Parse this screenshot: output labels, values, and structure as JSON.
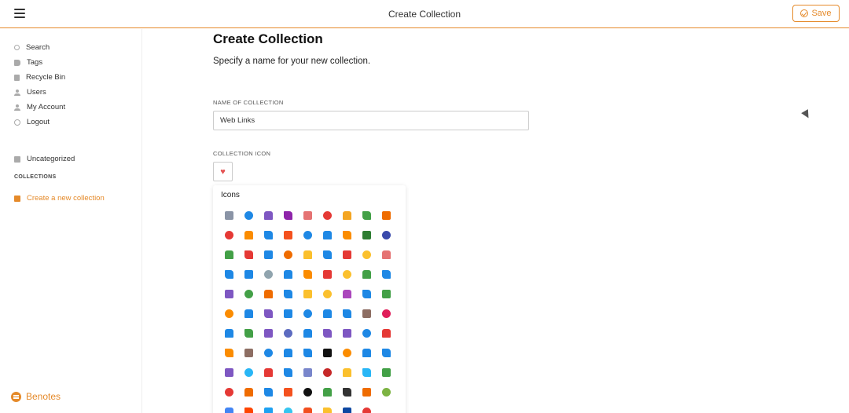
{
  "topbar": {
    "title": "Create Collection",
    "save_label": "Save"
  },
  "sidebar": {
    "items": [
      {
        "label": "Search",
        "icon": "search-icon"
      },
      {
        "label": "Tags",
        "icon": "tag-icon"
      },
      {
        "label": "Recycle Bin",
        "icon": "trash-icon"
      },
      {
        "label": "Users",
        "icon": "users-icon"
      },
      {
        "label": "My Account",
        "icon": "user-icon"
      },
      {
        "label": "Logout",
        "icon": "logout-icon"
      }
    ],
    "uncategorized": "Uncategorized",
    "collections_label": "COLLECTIONS",
    "create_link": "Create a new collection",
    "brand": "Benotes"
  },
  "main": {
    "title": "Create Collection",
    "subtitle": "Specify a name for your new collection.",
    "name_label": "NAME OF COLLECTION",
    "name_value": "Web Links",
    "icon_label": "COLLECTION ICON",
    "selected_icon": "heart-icon",
    "icons_title": "Icons"
  },
  "colors": {
    "accent": "#e58a2a",
    "heart": "#e55353"
  },
  "icons": [
    {
      "name": "folder-icon",
      "color": "#8a94a6"
    },
    {
      "name": "ring-icon",
      "color": "#1e88e5"
    },
    {
      "name": "triangle-icon",
      "color": "#7e57c2"
    },
    {
      "name": "hexagon-icon",
      "color": "#8e24aa"
    },
    {
      "name": "heart-outline-icon",
      "color": "#e57373"
    },
    {
      "name": "heart-icon",
      "color": "#e53935"
    },
    {
      "name": "star-icon",
      "color": "#f4a522"
    },
    {
      "name": "shield-icon",
      "color": "#43a047"
    },
    {
      "name": "chevron-up-icon",
      "color": "#ef6c00"
    },
    {
      "name": "user-badge-icon",
      "color": "#e53935"
    },
    {
      "name": "group-icon",
      "color": "#fb8c00"
    },
    {
      "name": "cloud-icon",
      "color": "#1e88e5"
    },
    {
      "name": "fire-icon",
      "color": "#f4511e"
    },
    {
      "name": "drop-icon",
      "color": "#1e88e5"
    },
    {
      "name": "bolt-icon",
      "color": "#1e88e5"
    },
    {
      "name": "sun-icon",
      "color": "#fb8c00"
    },
    {
      "name": "tree-icon",
      "color": "#2e7d32"
    },
    {
      "name": "lotus-icon",
      "color": "#3949ab"
    },
    {
      "name": "globe-icon",
      "color": "#43a047"
    },
    {
      "name": "compass-icon",
      "color": "#e53935"
    },
    {
      "name": "arrow-up-icon",
      "color": "#1e88e5"
    },
    {
      "name": "map-icon",
      "color": "#ef6c00"
    },
    {
      "name": "flag-icon",
      "color": "#fbc02d"
    },
    {
      "name": "flag-blue-icon",
      "color": "#1e88e5"
    },
    {
      "name": "flag-red-icon",
      "color": "#e53935"
    },
    {
      "name": "binoculars-icon",
      "color": "#fbc02d"
    },
    {
      "name": "clock-icon",
      "color": "#e57373"
    },
    {
      "name": "mail-icon",
      "color": "#1e88e5"
    },
    {
      "name": "inbox-icon",
      "color": "#1e88e5"
    },
    {
      "name": "paperclip-icon",
      "color": "#90a4ae"
    },
    {
      "name": "window-icon",
      "color": "#1e88e5"
    },
    {
      "name": "bookmark-icon",
      "color": "#fb8c00"
    },
    {
      "name": "warning-icon",
      "color": "#e53935"
    },
    {
      "name": "bell-icon",
      "color": "#fbc02d"
    },
    {
      "name": "circles-icon",
      "color": "#43a047"
    },
    {
      "name": "layers-icon",
      "color": "#1e88e5"
    },
    {
      "name": "graduation-icon",
      "color": "#7e57c2"
    },
    {
      "name": "book-icon",
      "color": "#43a047"
    },
    {
      "name": "books-icon",
      "color": "#ef6c00"
    },
    {
      "name": "bar-chart-icon",
      "color": "#1e88e5"
    },
    {
      "name": "palette-icon",
      "color": "#fbc02d"
    },
    {
      "name": "ruler-icon",
      "color": "#fbc02d"
    },
    {
      "name": "factory-icon",
      "color": "#ab47bc"
    },
    {
      "name": "cart-icon",
      "color": "#1e88e5"
    },
    {
      "name": "money-icon",
      "color": "#43a047"
    },
    {
      "name": "box-icon",
      "color": "#fb8c00"
    },
    {
      "name": "cup-icon",
      "color": "#1e88e5"
    },
    {
      "name": "phone-icon",
      "color": "#7e57c2"
    },
    {
      "name": "laptop-icon",
      "color": "#1e88e5"
    },
    {
      "name": "diamond-icon",
      "color": "#1e88e5"
    },
    {
      "name": "sync-icon",
      "color": "#1e88e5"
    },
    {
      "name": "upload-icon",
      "color": "#1e88e5"
    },
    {
      "name": "briefcase-icon",
      "color": "#8d6e63"
    },
    {
      "name": "slack-icon",
      "color": "#e01e5a"
    },
    {
      "name": "play-icon",
      "color": "#1e88e5"
    },
    {
      "name": "image-icon",
      "color": "#43a047"
    },
    {
      "name": "film-icon",
      "color": "#7e57c2"
    },
    {
      "name": "grid-icon",
      "color": "#5c6bc0"
    },
    {
      "name": "mic-icon",
      "color": "#1e88e5"
    },
    {
      "name": "music-icon",
      "color": "#7e57c2"
    },
    {
      "name": "gamepad-icon",
      "color": "#7e57c2"
    },
    {
      "name": "robot-icon",
      "color": "#1e88e5"
    },
    {
      "name": "rocket-icon",
      "color": "#e53935"
    },
    {
      "name": "home-icon",
      "color": "#fb8c00"
    },
    {
      "name": "building-icon",
      "color": "#8d6e63"
    },
    {
      "name": "gear-icon",
      "color": "#1e88e5"
    },
    {
      "name": "magnifier-icon",
      "color": "#1e88e5"
    },
    {
      "name": "trash-icon",
      "color": "#1e88e5"
    },
    {
      "name": "github-icon",
      "color": "#111111"
    },
    {
      "name": "gitlab-icon",
      "color": "#fb8c00"
    },
    {
      "name": "vscode-icon",
      "color": "#1e88e5"
    },
    {
      "name": "docker-icon",
      "color": "#1e88e5"
    },
    {
      "name": "csharp-icon",
      "color": "#7e57c2"
    },
    {
      "name": "go-icon",
      "color": "#29b6f6"
    },
    {
      "name": "java-icon",
      "color": "#e53935"
    },
    {
      "name": "python-icon",
      "color": "#1e88e5"
    },
    {
      "name": "php-icon",
      "color": "#7986cb"
    },
    {
      "name": "ruby-icon",
      "color": "#c62828"
    },
    {
      "name": "js-icon",
      "color": "#fbc02d"
    },
    {
      "name": "react-icon",
      "color": "#29b6f6"
    },
    {
      "name": "vue-icon",
      "color": "#43a047"
    },
    {
      "name": "angular-icon",
      "color": "#e53935"
    },
    {
      "name": "html5-icon",
      "color": "#ef6c00"
    },
    {
      "name": "wordpress-icon",
      "color": "#1e88e5"
    },
    {
      "name": "swift-icon",
      "color": "#f4511e"
    },
    {
      "name": "apple-icon",
      "color": "#111111"
    },
    {
      "name": "windows-icon",
      "color": "#43a047"
    },
    {
      "name": "linux-icon",
      "color": "#333333"
    },
    {
      "name": "ubuntu-icon",
      "color": "#ef6c00"
    },
    {
      "name": "android-icon",
      "color": "#7cb342"
    },
    {
      "name": "google-icon",
      "color": "#4285f4"
    },
    {
      "name": "reddit-icon",
      "color": "#ff4500"
    },
    {
      "name": "twitter-icon",
      "color": "#1da1f2"
    },
    {
      "name": "slack-alt-icon",
      "color": "#36c5f0"
    },
    {
      "name": "figma-icon",
      "color": "#f24e1e"
    },
    {
      "name": "sketch-icon",
      "color": "#fbc02d"
    },
    {
      "name": "photoshop-icon",
      "color": "#0d47a1"
    },
    {
      "name": "angular-alt-icon",
      "color": "#e53935"
    },
    {
      "name": "blank-icon",
      "color": "#ffffff"
    }
  ]
}
